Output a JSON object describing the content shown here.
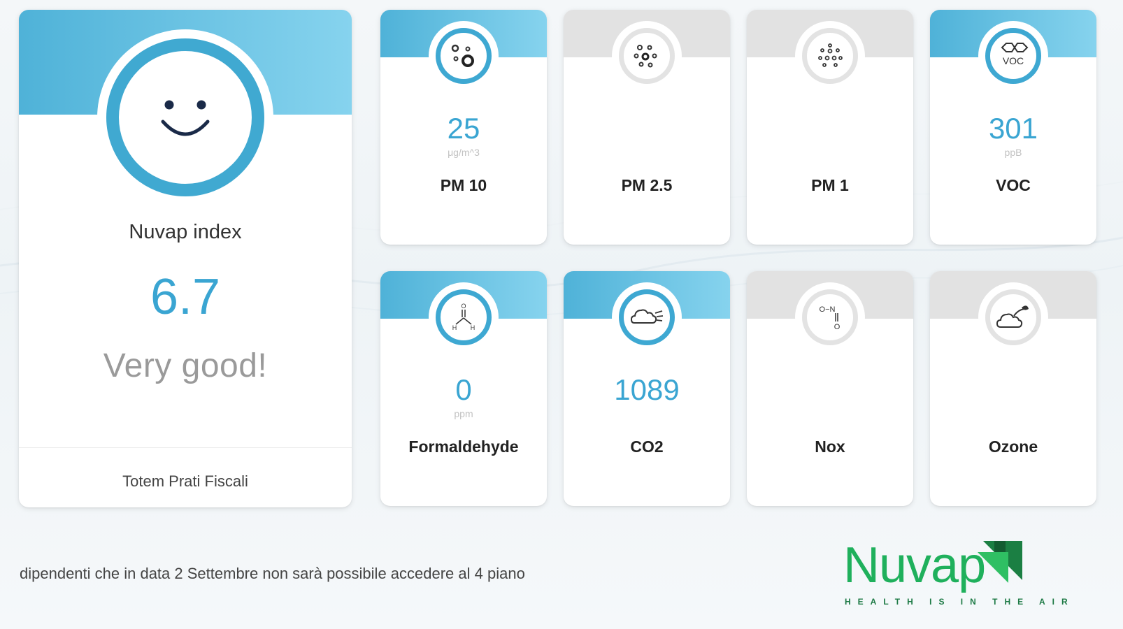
{
  "colors": {
    "accent": "#3aa5d2",
    "inactive": "#e2e2e2",
    "brand_green": "#1fb05c"
  },
  "index_card": {
    "icon": "smiley-face-icon",
    "title": "Nuvap index",
    "value": "6.7",
    "rating": "Very good!",
    "location": "Totem Prati Fiscali"
  },
  "sensors": [
    {
      "name": "PM 10",
      "value": "25",
      "unit": "μg/m^3",
      "active": true,
      "icon": "pm10-particles-icon"
    },
    {
      "name": "PM 2.5",
      "value": "",
      "unit": "",
      "active": false,
      "icon": "pm25-particles-icon"
    },
    {
      "name": "PM 1",
      "value": "",
      "unit": "",
      "active": false,
      "icon": "pm1-particles-icon"
    },
    {
      "name": "VOC",
      "value": "301",
      "unit": "ppB",
      "active": true,
      "icon": "voc-molecule-icon",
      "icon_text": "VOC"
    },
    {
      "name": "Formaldehyde",
      "value": "0",
      "unit": "ppm",
      "active": true,
      "icon": "formaldehyde-molecule-icon"
    },
    {
      "name": "CO2",
      "value": "1089",
      "unit": "",
      "active": true,
      "icon": "co2-cloud-icon"
    },
    {
      "name": "Nox",
      "value": "",
      "unit": "",
      "active": false,
      "icon": "nox-molecule-icon",
      "icon_text": "O−N"
    },
    {
      "name": "Ozone",
      "value": "",
      "unit": "",
      "active": false,
      "icon": "ozone-cloud-icon"
    }
  ],
  "ticker": "dipendenti che in data 2 Settembre non sarà possibile accedere al 4 piano",
  "logo": {
    "word": "Nuvap",
    "tagline": "HEALTH IS IN THE AIR"
  }
}
